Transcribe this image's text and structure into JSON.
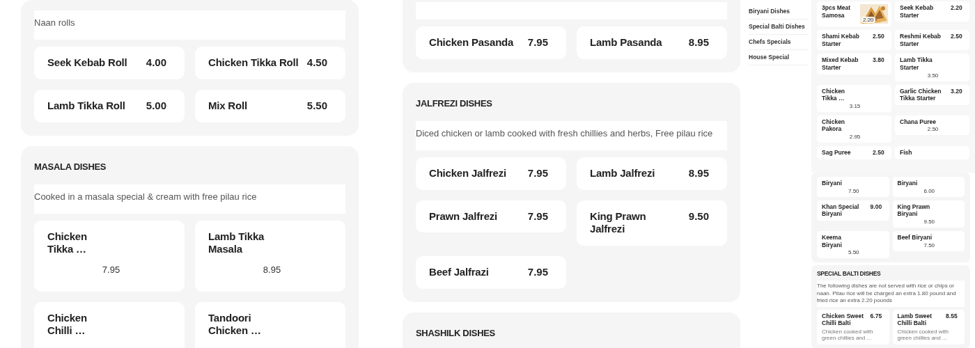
{
  "columns": [
    {
      "sections": [
        {
          "description": "Naan rolls",
          "items": [
            {
              "name": "Seek Kebab Roll",
              "price": "4.00",
              "kind": "inline"
            },
            {
              "name": "Chicken Tikka Roll",
              "price": "4.50",
              "kind": "inline"
            },
            {
              "name": "Lamb Tikka Roll",
              "price": "5.00",
              "kind": "inline"
            },
            {
              "name": "Mix Roll",
              "price": "5.50",
              "kind": "inline"
            }
          ]
        },
        {
          "title": "MASALA DISHES",
          "description": "Cooked in a masala special & cream with free pilau rice",
          "items": [
            {
              "name": "Chicken Tikka …",
              "price": "7.95",
              "kind": "stacked"
            },
            {
              "name": "Lamb Tikka Masala",
              "price": "8.95",
              "kind": "stacked"
            },
            {
              "name": "Chicken Chilli …",
              "kind": "stacked"
            },
            {
              "name": "Tandoori Chicken …",
              "kind": "stacked"
            }
          ]
        }
      ]
    },
    {
      "sections": [
        {
          "items": [
            {
              "name": "Chicken Pasanda",
              "price": "7.95",
              "kind": "inline"
            },
            {
              "name": "Lamb Pasanda",
              "price": "8.95",
              "kind": "inline"
            }
          ]
        },
        {
          "title": "JALFREZI DISHES",
          "description": "Diced chicken or lamb cooked with fresh chillies and herbs, Free pilau rice",
          "items": [
            {
              "name": "Chicken Jalfrezi",
              "price": "7.95",
              "kind": "inline"
            },
            {
              "name": "Lamb Jalfrezi",
              "price": "8.95",
              "kind": "inline"
            },
            {
              "name": "Prawn Jalfrezi",
              "price": "7.95",
              "kind": "inline"
            },
            {
              "name": "King Prawn Jalfrezi",
              "price": "9.50",
              "kind": "inline"
            },
            {
              "name": "Beef Jalfrazi",
              "price": "7.95",
              "kind": "inline"
            }
          ]
        },
        {
          "title": "SHASHILK DISHES"
        }
      ]
    }
  ],
  "mini": {
    "sidebar": [
      "Biryani Dishes",
      "Special Balti Dishes",
      "Chefs Specials",
      "House Special"
    ],
    "top": {
      "items": [
        {
          "name": "3pcs Meat Samosa",
          "price": "2.20"
        },
        {
          "name": "Seek Kebab Starter",
          "price": "2.20",
          "kind": "inline"
        },
        {
          "name": "Shami Kebab Starter",
          "price": "2.50",
          "kind": "inline"
        },
        {
          "name": "Reshmi Kebab Starter",
          "price": "2.50",
          "kind": "inline"
        },
        {
          "name": "Mixed Kebab Starter",
          "price": "3.80",
          "kind": "inline"
        },
        {
          "name": "Lamb Tikka Starter",
          "price": "3.50",
          "kind": "stacked"
        },
        {
          "name": "Chicken Tikka …",
          "price": "3.15",
          "kind": "stacked"
        },
        {
          "name": "Garlic Chicken Tikka Starter",
          "price": "3.20",
          "kind": "inline"
        },
        {
          "name": "Chicken Pakora",
          "price": "2.95",
          "kind": "stacked"
        },
        {
          "name": "Chana Puree",
          "price": "2.50",
          "kind": "stacked"
        },
        {
          "name": "Sag Puree",
          "price": "2.50",
          "kind": "inline"
        },
        {
          "name": "Fish",
          "kind": "inline"
        }
      ]
    },
    "bottom": [
      {
        "items": [
          {
            "name": "Biryani",
            "price": "7.50",
            "kind": "stacked"
          },
          {
            "name": "Biryani",
            "price": "6.00",
            "kind": "stacked"
          },
          {
            "name": "Khan Special Biryani",
            "price": "9.00",
            "kind": "inline"
          },
          {
            "name": "King Prawn Biryani",
            "price": "9.50",
            "kind": "stacked"
          },
          {
            "name": "Keema Biryani",
            "price": "5.50",
            "kind": "stacked"
          },
          {
            "name": "Beef Biryani",
            "price": "7.50",
            "kind": "stacked"
          }
        ]
      },
      {
        "title": "SPECIAL BALTI DISHES",
        "description": "The following dishes are not served with rice or chips or naan. Pilau rice will be charged an extra 1.80 pound and fried rice an extra 2.20 pounds",
        "items": [
          {
            "name": "Chicken Sweet Chilli Balti",
            "price": "6.75",
            "kind": "inline",
            "description": "Chicken cooked with green chillies and ..."
          },
          {
            "name": "Lamb Sweet Chilli Balti",
            "price": "8.55",
            "kind": "inline",
            "description": "Chicken cooked with green chillies and ..."
          }
        ]
      }
    ]
  }
}
